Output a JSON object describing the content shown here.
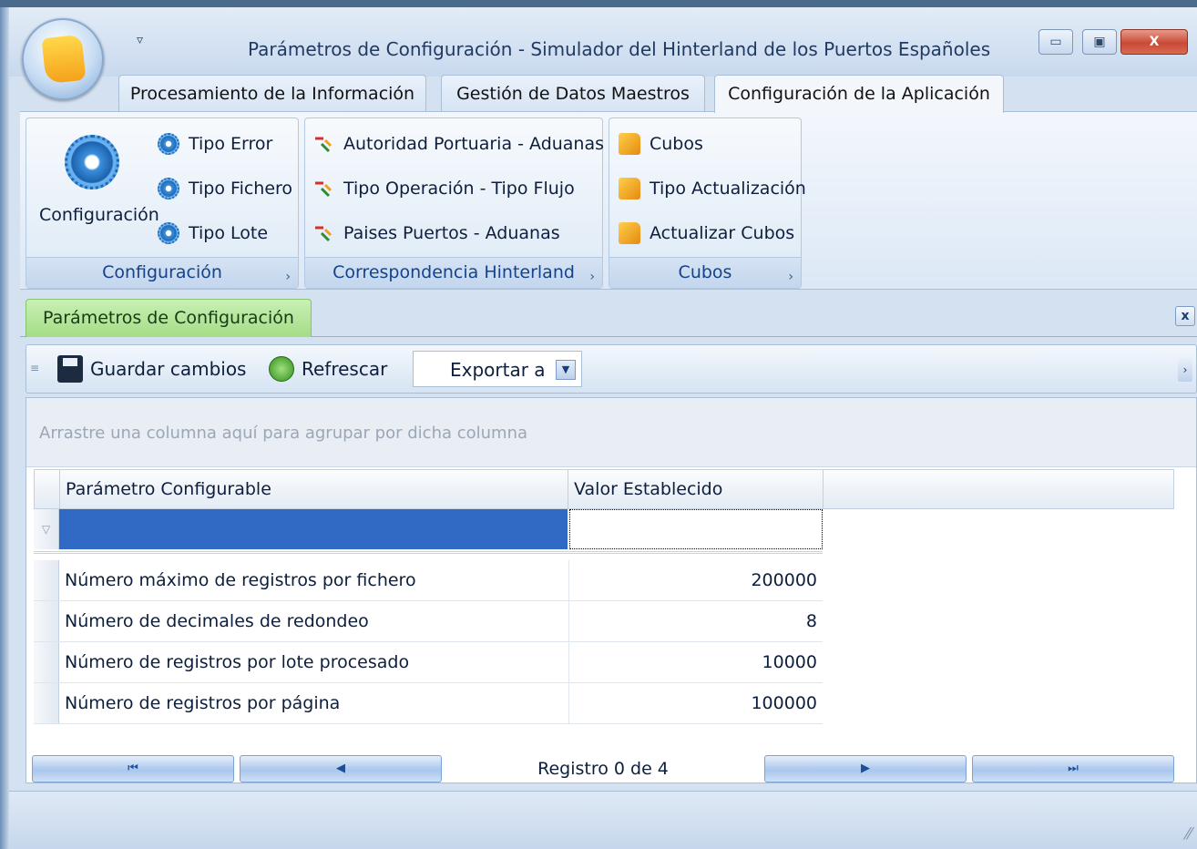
{
  "window": {
    "title": "Parámetros de Configuración - Simulador del Hinterland de los Puertos Españoles",
    "qat_icon": "chevron-down-icon",
    "controls": [
      "minimize",
      "maximize",
      "close"
    ]
  },
  "ribbon": {
    "tabs": [
      {
        "label": "Procesamiento de la Información",
        "active": false
      },
      {
        "label": "Gestión de Datos Maestros",
        "active": false
      },
      {
        "label": "Configuración de la Aplicación",
        "active": true
      }
    ],
    "groups": [
      {
        "label": "Configuración",
        "large_button": {
          "label": "Configuración",
          "icon": "gear-icon"
        },
        "items": [
          {
            "label": "Tipo Error",
            "icon": "gear-icon"
          },
          {
            "label": "Tipo Fichero",
            "icon": "gear-icon"
          },
          {
            "label": "Tipo Lote",
            "icon": "gear-icon"
          }
        ]
      },
      {
        "label": "Correspondencia Hinterland",
        "items": [
          {
            "label": "Autoridad Portuaria - Aduanas",
            "icon": "mapping-arrows-icon"
          },
          {
            "label": "Tipo Operación - Tipo Flujo",
            "icon": "mapping-arrows-icon"
          },
          {
            "label": "Paises Puertos - Aduanas",
            "icon": "mapping-arrows-icon"
          }
        ]
      },
      {
        "label": "Cubos",
        "items": [
          {
            "label": "Cubos",
            "icon": "cube-icon"
          },
          {
            "label": "Tipo Actualización",
            "icon": "cube-icon"
          },
          {
            "label": "Actualizar Cubos",
            "icon": "cube-icon"
          }
        ]
      }
    ],
    "launcher_glyph": "›"
  },
  "document": {
    "tab_label": "Parámetros de Configuración",
    "close_glyph": "x"
  },
  "toolbar": {
    "save_label": "Guardar cambios",
    "refresh_label": "Refrescar",
    "export_label": "Exportar a"
  },
  "grid": {
    "group_panel_text": "Arrastre una columna aquí para agrupar por dicha columna",
    "columns": [
      "Parámetro Configurable",
      "Valor Establecido"
    ],
    "rows": [
      {
        "param": "Número máximo de registros por fichero",
        "value": "200000"
      },
      {
        "param": "Número de decimales de redondeo",
        "value": "8"
      },
      {
        "param": "Número de registros por lote procesado",
        "value": "10000"
      },
      {
        "param": "Número de registros por página",
        "value": "100000"
      }
    ],
    "navigator_text": "Registro 0 de 4"
  },
  "colors": {
    "selection": "#316ac5",
    "active_doc_tab": "#a4dd86",
    "title_text": "#1f3b63"
  }
}
